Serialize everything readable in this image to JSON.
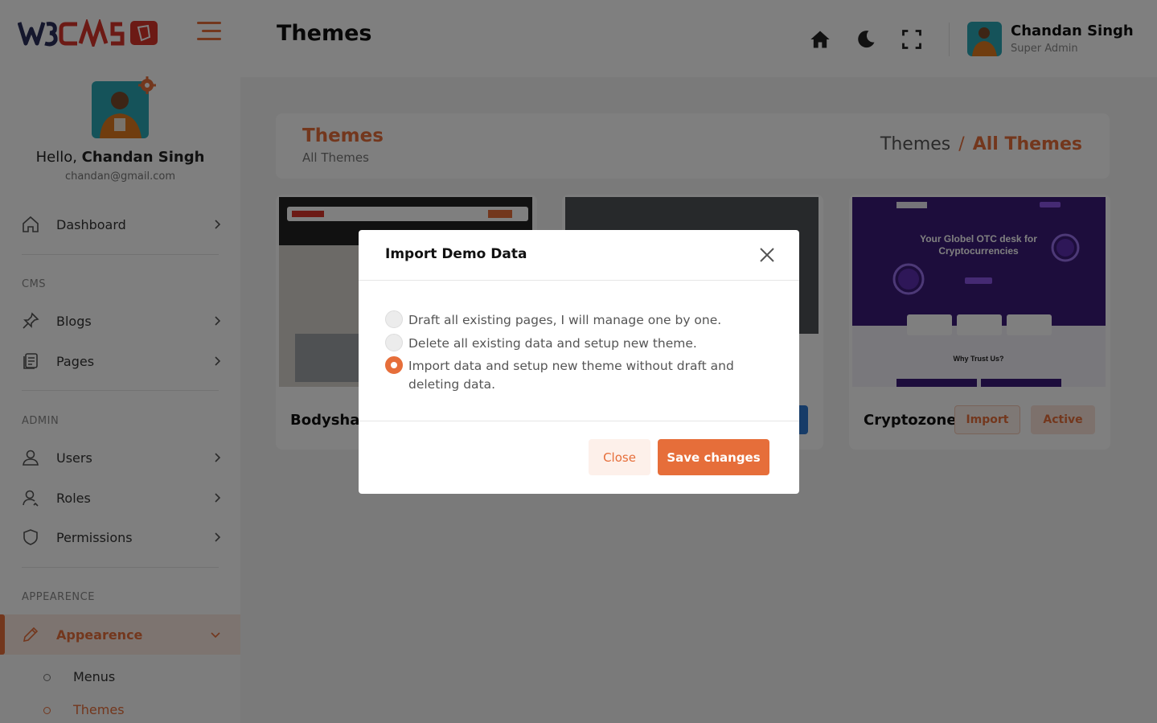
{
  "header": {
    "title": "Themes",
    "user_name": "Chandan Singh",
    "user_role": "Super Admin"
  },
  "sidebar": {
    "greeting": "Hello,",
    "user_name": "Chandan Singh",
    "email": "chandan@gmail.com",
    "dashboard": "Dashboard",
    "section_cms": "CMS",
    "blogs": "Blogs",
    "pages": "Pages",
    "section_admin": "ADMIN",
    "users": "Users",
    "roles": "Roles",
    "permissions": "Permissions",
    "section_appearance": "APPEARENCE",
    "appearance": "Appearence",
    "submenu": [
      "Menus",
      "Themes"
    ]
  },
  "content": {
    "card_title": "Themes",
    "card_subtitle": "All Themes",
    "breadcrumb": [
      "Themes",
      "All Themes"
    ],
    "themes": [
      {
        "name": "Bodyshape"
      },
      {
        "name": "Cryptozone",
        "import_label": "Import",
        "active_label": "Active"
      }
    ],
    "crypto_thumb": {
      "headline_1": "Your Globel OTC desk for",
      "headline_2": "Cryptocurrencies",
      "why": "Why Trust Us?"
    }
  },
  "modal": {
    "title": "Import Demo Data",
    "options": [
      "Draft all existing pages, I will manage one by one.",
      "Delete all existing data and setup new theme.",
      "Import data and setup new theme without draft and deleting data."
    ],
    "selected_index": 2,
    "close_label": "Close",
    "save_label": "Save changes"
  },
  "colors": {
    "accent": "#e66e3a",
    "accent_light": "#fdf0ea",
    "crypto_purple": "#3a1a78"
  }
}
